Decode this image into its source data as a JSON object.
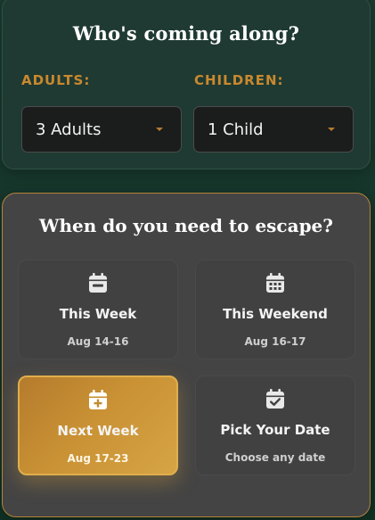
{
  "party": {
    "title": "Who's coming along?",
    "adults": {
      "label": "ADULTS:",
      "value": "3 Adults"
    },
    "children": {
      "label": "CHILDREN:",
      "value": "1 Child"
    }
  },
  "escape": {
    "title": "When do you need to escape?",
    "options": [
      {
        "icon": "calendar-minus-icon",
        "title": "This Week",
        "subtitle": "Aug 14-16",
        "selected": false
      },
      {
        "icon": "calendar-grid-icon",
        "title": "This Weekend",
        "subtitle": "Aug 16-17",
        "selected": false
      },
      {
        "icon": "calendar-plus-icon",
        "title": "Next Week",
        "subtitle": "Aug 17-23",
        "selected": true
      },
      {
        "icon": "calendar-check-icon",
        "title": "Pick Your Date",
        "subtitle": "Choose any date",
        "selected": false
      }
    ]
  },
  "colors": {
    "accent": "#c9892e",
    "selected_gradient_start": "#b57b2d",
    "selected_gradient_end": "#d6a445",
    "card_dark_green": "#1f3a32",
    "card_gray": "#444444"
  }
}
